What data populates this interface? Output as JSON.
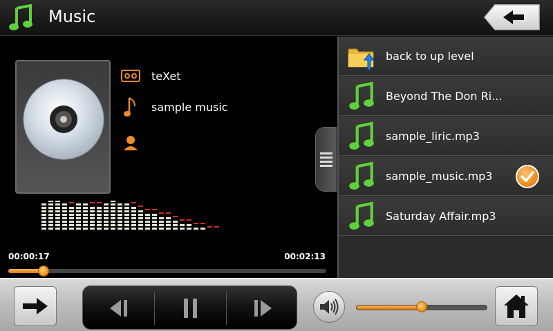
{
  "header": {
    "title": "Music",
    "app_icon": "music-note-icon",
    "back_icon": "arrow-left-icon"
  },
  "now_playing": {
    "album_icon": "cd-disc-icon",
    "artist": "teXet",
    "album": "sample music",
    "composer": "",
    "current_time": "00:00:17",
    "total_time": "00:02:13",
    "progress": 0.11
  },
  "playlist": {
    "items": [
      {
        "label": "back to up level",
        "icon": "folder-up-icon",
        "selected": false
      },
      {
        "label": "Beyond The Don Ri...",
        "icon": "music-note-icon",
        "selected": false
      },
      {
        "label": "sample_liric.mp3",
        "icon": "music-note-icon",
        "selected": false
      },
      {
        "label": "sample_music.mp3",
        "icon": "music-note-icon",
        "selected": true
      },
      {
        "label": "Saturday Affair.mp3",
        "icon": "music-note-icon",
        "selected": false
      }
    ]
  },
  "controls": {
    "volume": 0.5,
    "icons": [
      "arrow-right-icon",
      "previous-icon",
      "pause-icon",
      "next-icon",
      "speaker-icon",
      "home-icon"
    ]
  },
  "colors": {
    "accent": "#e8861a",
    "note_green": "#58c23a"
  }
}
